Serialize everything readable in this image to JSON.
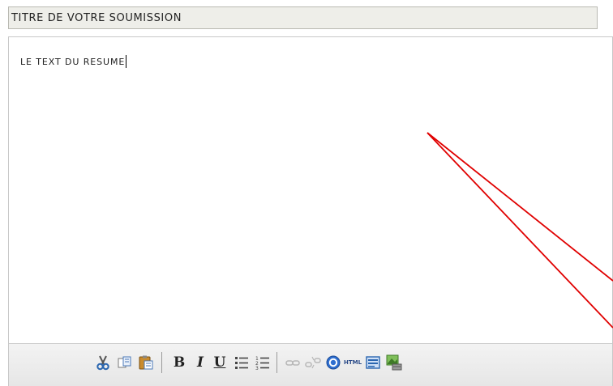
{
  "title_field": {
    "value": "TITRE DE VOTRE SOUMISSION"
  },
  "editor": {
    "content": "LE TEXT DU RESUME"
  },
  "toolbar": {
    "buttons": [
      "cut-icon",
      "copy-icon",
      "paste-icon",
      "bold",
      "italic",
      "underline",
      "bulleted-list-icon",
      "numbered-list-icon",
      "link-icon",
      "unlink-icon",
      "help-icon",
      "html-source",
      "layout-icon",
      "insert-image-icon"
    ],
    "bold_label": "B",
    "italic_label": "I",
    "underline_label": "U",
    "html_label": "HTML"
  },
  "colors": {
    "annotation_arrow": "#e00000",
    "toolbar_bg": "#ebebeb",
    "title_bg": "#eeeee9"
  }
}
